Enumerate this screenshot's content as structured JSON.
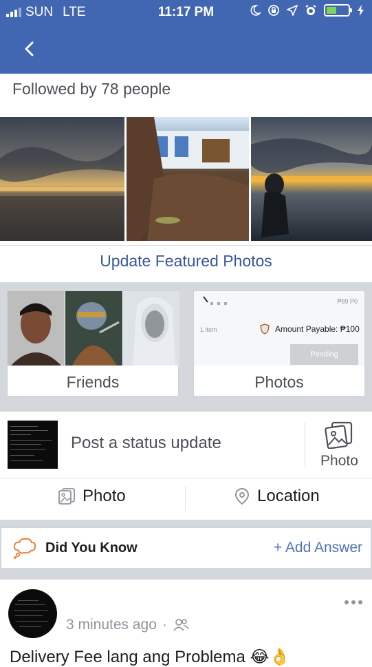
{
  "status_bar": {
    "carrier": "SUN",
    "network": "LTE",
    "time": "11:17 PM"
  },
  "header": {
    "back_icon": "chevron-left-icon"
  },
  "followers": {
    "text": "Followed by 78 people"
  },
  "featured": {
    "update_label": "Update Featured Photos",
    "photos": [
      "sunset-over-water",
      "tree-root-near-house",
      "person-by-shore-at-dusk"
    ]
  },
  "tiles": {
    "friends_label": "Friends",
    "photos_label": "Photos",
    "receipt": {
      "price_text": "₱89 P0",
      "items_text": "1 item",
      "amount_label": "Amount Payable: ₱100",
      "status_label": "Pending"
    }
  },
  "composer": {
    "placeholder": "Post a status update",
    "photo_label": "Photo"
  },
  "actions": {
    "photo_label": "Photo",
    "location_label": "Location"
  },
  "did_you_know": {
    "title": "Did You Know",
    "add_answer": "+ Add Answer"
  },
  "post": {
    "time": "3 minutes ago",
    "separator": "·",
    "audience_icon": "friends-icon",
    "text": "Delivery Fee lang ang Problema 😂👌"
  },
  "colors": {
    "brand": "#4267b2",
    "link": "#365899",
    "divider": "#d4d7dc"
  }
}
